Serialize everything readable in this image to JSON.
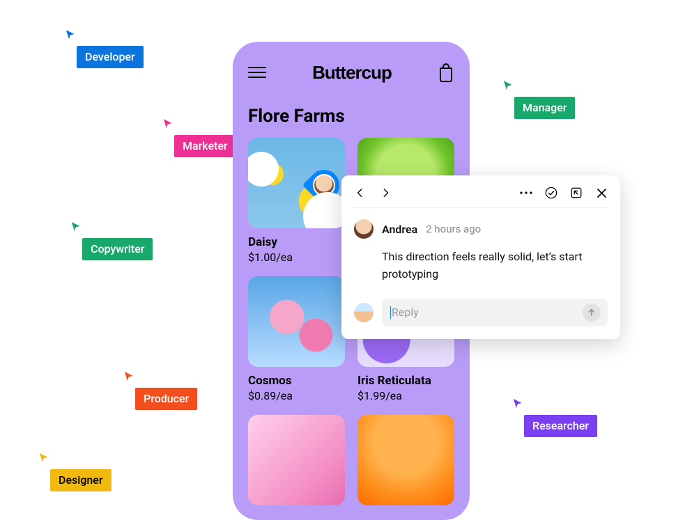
{
  "cursors": {
    "developer": {
      "label": "Developer",
      "color": "#0b74de"
    },
    "marketer": {
      "label": "Marketer",
      "color": "#ee2e92"
    },
    "manager": {
      "label": "Manager",
      "color": "#17a86b"
    },
    "copywriter": {
      "label": "Copywriter",
      "color": "#17a86b"
    },
    "producer": {
      "label": "Producer",
      "color": "#f24e1e"
    },
    "designer": {
      "label": "Designer",
      "color": "#f2b90f"
    },
    "researcher": {
      "label": "Researcher",
      "color": "#7b3ff2"
    }
  },
  "phone": {
    "brand": "Buttercup",
    "store_title": "Flore Farms",
    "products": [
      {
        "name": "Daisy",
        "price": "$1.00/ea"
      },
      {
        "name": "",
        "price": ""
      },
      {
        "name": "Cosmos",
        "price": "$0.89/ea"
      },
      {
        "name": "Iris Reticulata",
        "price": "$1.99/ea"
      },
      {
        "name": "",
        "price": ""
      },
      {
        "name": "",
        "price": ""
      }
    ]
  },
  "comment": {
    "author": "Andrea",
    "time": "2 hours ago",
    "text": "This direction feels really solid, let’s start prototyping",
    "reply_placeholder": "Reply"
  }
}
